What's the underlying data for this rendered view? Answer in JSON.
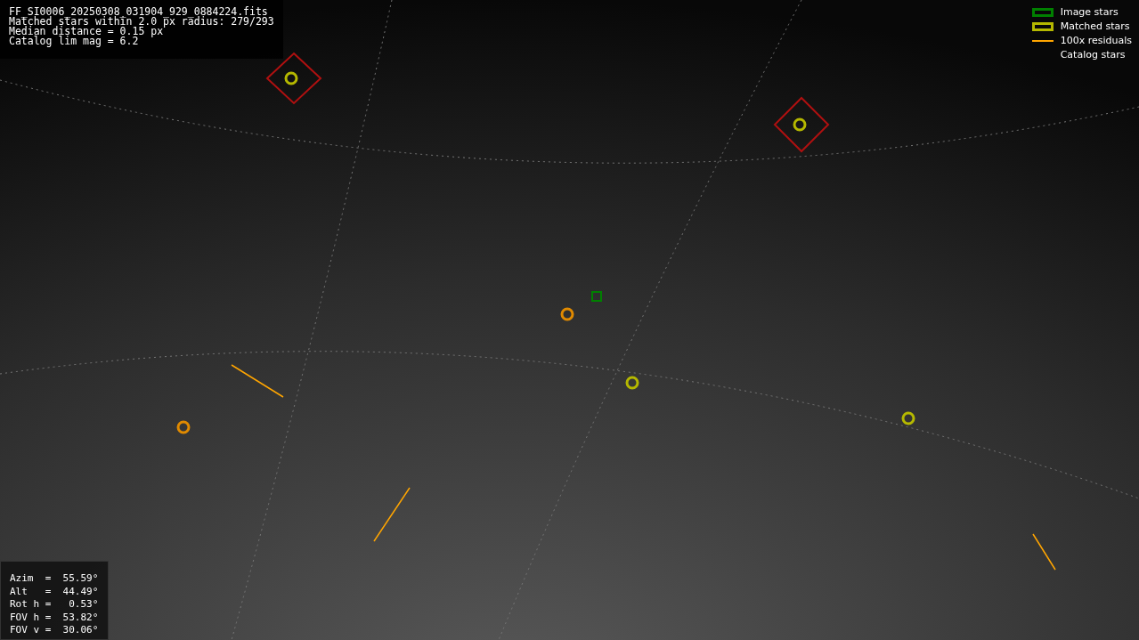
{
  "file_info": {
    "lines": [
      "FF_SI0006_20250308_031904_929_0884224.fits",
      "Matched stars within 2.0 px radius: 279/293",
      "Median distance = 0.15 px",
      "Catalog lim mag = 6.2"
    ]
  },
  "legend": [
    {
      "label": "Image stars",
      "kind": "box",
      "color": "#008000"
    },
    {
      "label": "Matched stars",
      "kind": "box",
      "color": "#b5b800"
    },
    {
      "label": "100x residuals",
      "kind": "line",
      "color": "#ffa500"
    },
    {
      "label": "Catalog stars",
      "kind": "blank"
    }
  ],
  "pointing": {
    "rows": [
      "Azim  =  55.59°",
      "Alt   =  44.49°",
      "Rot h =   0.53°",
      "FOV h =  53.82°",
      "FOV v =  30.06°"
    ]
  }
}
